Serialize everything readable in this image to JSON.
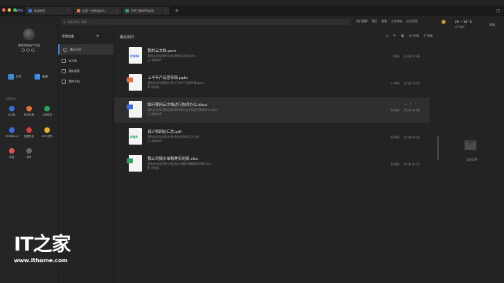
{
  "app": {
    "logo": "WPS"
  },
  "tabs": [
    {
      "label": "欢迎使用",
      "color": "#3b6fe0"
    },
    {
      "label": "这是一份使用的示...",
      "color": "#e2703a"
    },
    {
      "label": "手把了解WPS选项",
      "color": "#2fa35c"
    }
  ],
  "search": {
    "placeholder": "搜索文档，模板..."
  },
  "toplinks": [
    "热门搜索",
    "简历",
    "报表",
    "工作总结",
    "论文范文"
  ],
  "weather": {
    "icon": "sun-icon",
    "temp": "26 ~ 36 °C",
    "air": "空气良好",
    "city": "珠海"
  },
  "user": {
    "name": "我和文档有个约会"
  },
  "quick": {
    "open": "打开",
    "new": "新建"
  },
  "apps": {
    "title": "应用中心",
    "items": [
      {
        "label": "云文档",
        "color": "#3b6fe0"
      },
      {
        "label": "核对表格",
        "color": "#e2703a"
      },
      {
        "label": "文档修复",
        "color": "#2fa35c"
      },
      {
        "label": "PDF转Word",
        "color": "#3b6fe0"
      },
      {
        "label": "数据恢复",
        "color": "#c94040"
      },
      {
        "label": "WPS便签",
        "color": "#e6b02e"
      },
      {
        "label": "商量",
        "color": "#d9534f"
      },
      {
        "label": "更多",
        "color": "#666666"
      }
    ]
  },
  "nav": {
    "title": "常用位置",
    "items": [
      "最近访问",
      "云文档",
      "我的桌面",
      "我的文档"
    ]
  },
  "main": {
    "title": "最近访问",
    "time_label": "时间",
    "filter_label": "筛选",
    "files": [
      {
        "name": "我的云文档.pom",
        "ext": "POM",
        "ext_color": "#4a6fe0",
        "badge": "",
        "path": "我的云文档/我的文档/我的云文档.pom",
        "location": "本地文件",
        "size": "10KB",
        "date": "2018-11-06"
      },
      {
        "name": "上半年产品宣传稿.pptx",
        "ext": "",
        "ext_color": "#e2703a",
        "badge": "#e2703a",
        "path": "我的云文档/我的文档/上半年产品宣传稿.pptx",
        "location": "浏览器",
        "size": "2.1MB",
        "date": "2018-11-03"
      },
      {
        "name": "如何使用云文档进行协同办公.docx",
        "ext": "",
        "ext_color": "#3b6fe0",
        "badge": "#3b6fe0",
        "path": "我的云文档/我的文档/如何使用云文档进行协同办公.docx",
        "location": "本地文件",
        "size": "320KB",
        "date": "2018-10-06"
      },
      {
        "name": "设计类网站汇总.pdf",
        "ext": "PDF",
        "ext_color": "#2fa35c",
        "badge": "",
        "path": "我的云文档/我的文档/设计类网站汇总.pdf",
        "location": "本地文件",
        "size": "230KB",
        "date": "2018-10-04"
      },
      {
        "name": "我公司报价单精美实用版.xlsx",
        "ext": "",
        "ext_color": "#2fa35c",
        "badge": "#2fa35c",
        "path": "我的云文档/我的文档/我公司报价单精美实用版.xlsx",
        "location": "浏览器",
        "size": "150KB",
        "date": "2018-10-01"
      }
    ]
  },
  "right": {
    "no_msg": "暂无消息"
  },
  "watermark": {
    "logo": "IT之家",
    "url": "www.ithome.com"
  }
}
